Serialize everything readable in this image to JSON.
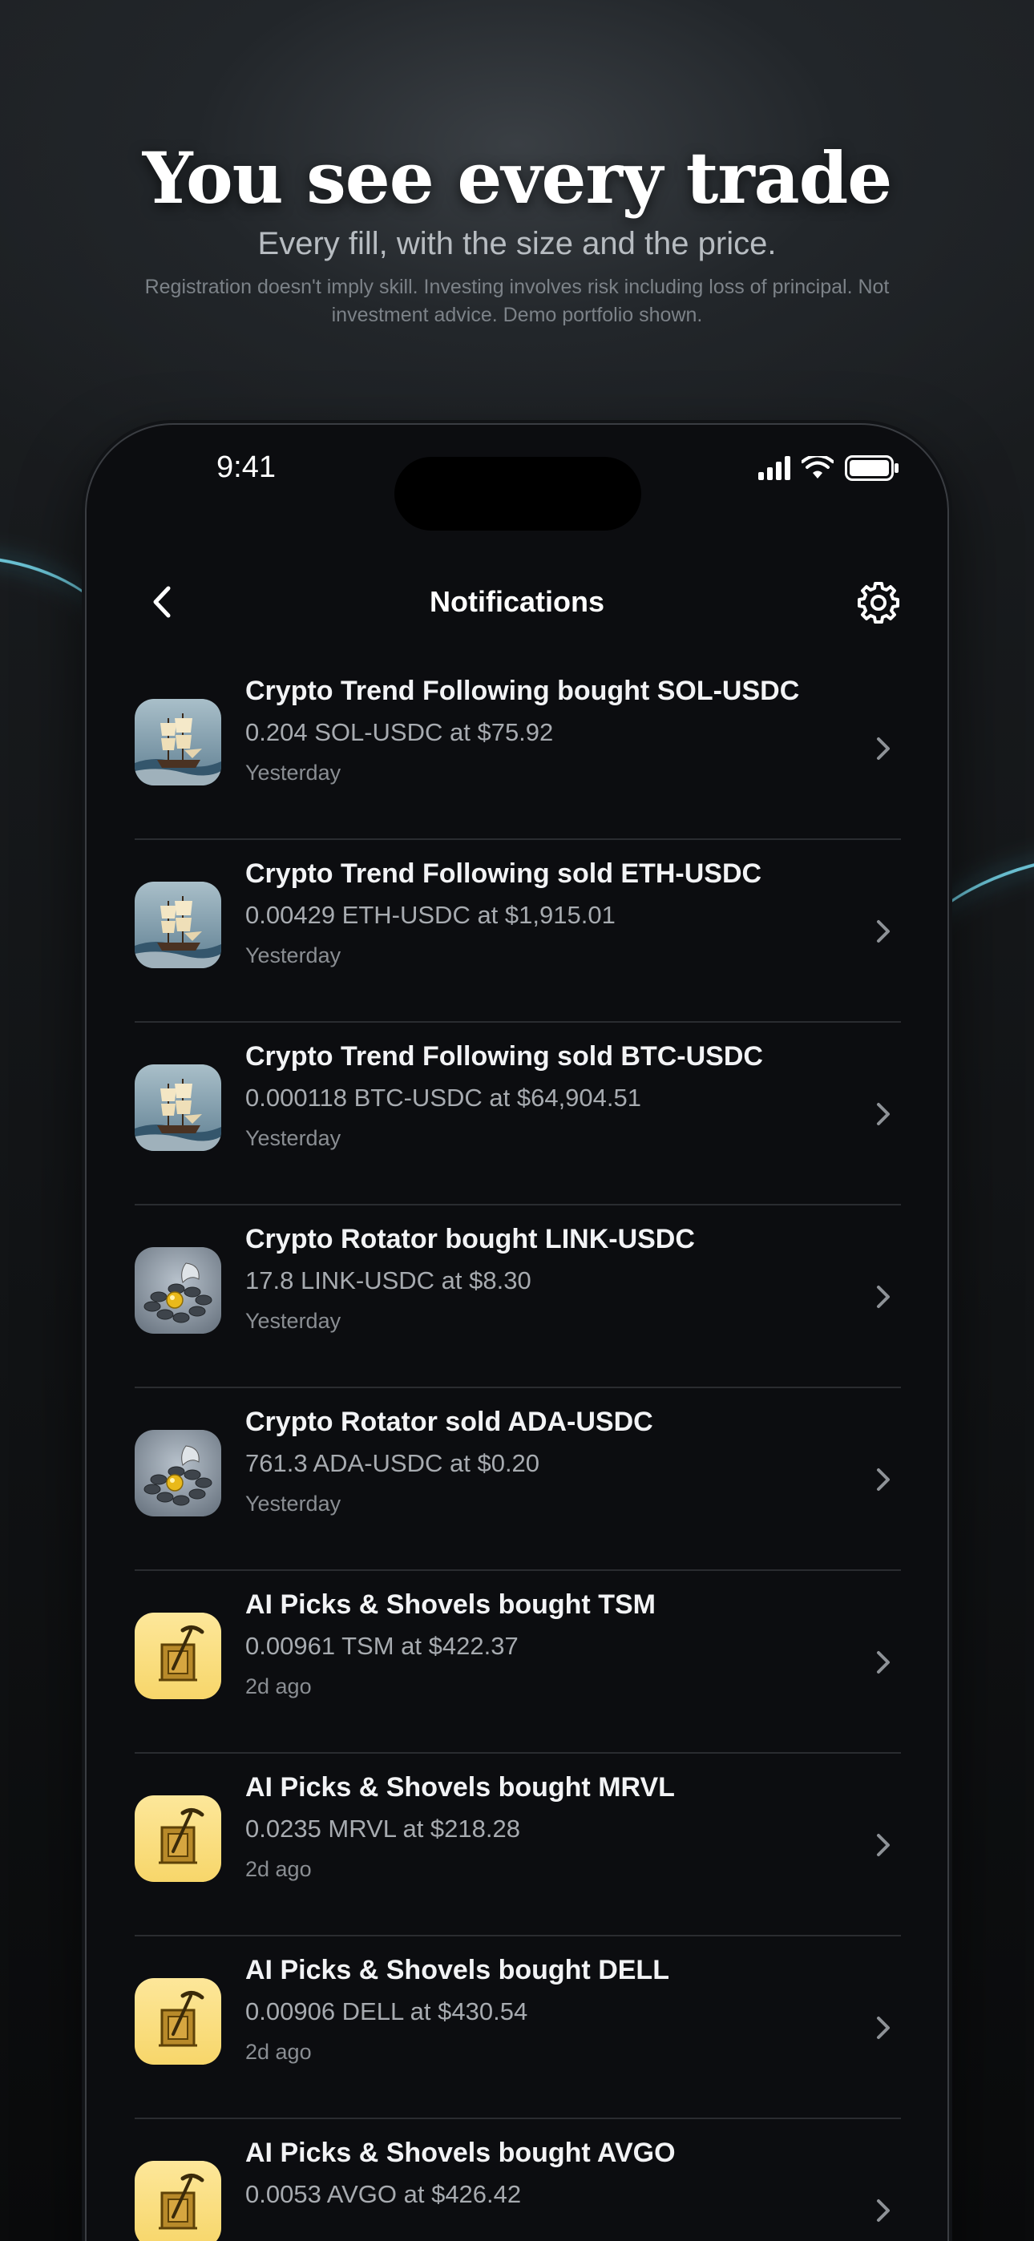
{
  "hero": {
    "title": "You see every trade",
    "subtitle": "Every fill, with the size and the price.",
    "disclaimer": "Registration doesn't imply skill. Investing involves risk including loss of principal. Not investment advice. Demo portfolio shown."
  },
  "status_bar": {
    "time": "9:41"
  },
  "nav": {
    "title": "Notifications",
    "back_icon": "chevron-left-icon",
    "settings_icon": "gear-icon"
  },
  "notifications": [
    {
      "title": "Crypto Trend Following bought SOL-USDC",
      "detail": "0.204 SOL-USDC at $75.92",
      "time": "Yesterday",
      "avatar": "ship"
    },
    {
      "title": "Crypto Trend Following sold ETH-USDC",
      "detail": "0.00429 ETH-USDC at $1,915.01",
      "time": "Yesterday",
      "avatar": "ship"
    },
    {
      "title": "Crypto Trend Following sold BTC-USDC",
      "detail": "0.000118 BTC-USDC at $64,904.51",
      "time": "Yesterday",
      "avatar": "ship"
    },
    {
      "title": "Crypto Rotator bought LINK-USDC",
      "detail": "17.8 LINK-USDC at $8.30",
      "time": "Yesterday",
      "avatar": "rotator"
    },
    {
      "title": "Crypto Rotator sold ADA-USDC",
      "detail": "761.3 ADA-USDC at $0.20",
      "time": "Yesterday",
      "avatar": "rotator"
    },
    {
      "title": "AI Picks & Shovels bought TSM",
      "detail": "0.00961 TSM at $422.37",
      "time": "2d ago",
      "avatar": "shovel"
    },
    {
      "title": "AI Picks & Shovels bought MRVL",
      "detail": "0.0235 MRVL at $218.28",
      "time": "2d ago",
      "avatar": "shovel"
    },
    {
      "title": "AI Picks & Shovels bought DELL",
      "detail": "0.00906 DELL at $430.54",
      "time": "2d ago",
      "avatar": "shovel"
    },
    {
      "title": "AI Picks & Shovels bought AVGO",
      "detail": "0.0053 AVGO at $426.42",
      "time": "",
      "avatar": "shovel"
    }
  ]
}
